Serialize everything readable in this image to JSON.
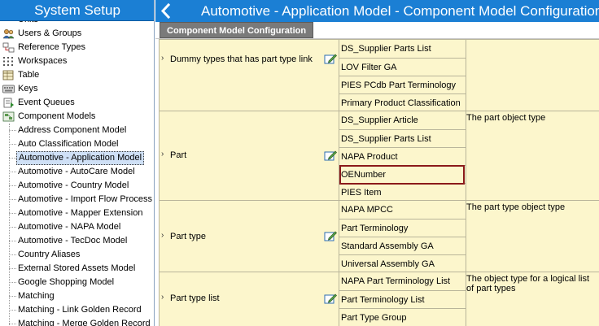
{
  "sidebar": {
    "title": "System Setup",
    "items": [
      {
        "label": "Units"
      },
      {
        "label": "Users & Groups"
      },
      {
        "label": "Reference Types"
      },
      {
        "label": "Workspaces"
      },
      {
        "label": "Table"
      },
      {
        "label": "Keys"
      },
      {
        "label": "Event Queues"
      },
      {
        "label": "Component Models"
      }
    ],
    "children": [
      {
        "label": "Address Component Model"
      },
      {
        "label": "Auto Classification Model"
      },
      {
        "label": "Automotive - Application Model"
      },
      {
        "label": "Automotive - AutoCare Model"
      },
      {
        "label": "Automotive - Country Model"
      },
      {
        "label": "Automotive - Import Flow Process"
      },
      {
        "label": "Automotive - Mapper Extension"
      },
      {
        "label": "Automotive - NAPA Model"
      },
      {
        "label": "Automotive - TecDoc Model"
      },
      {
        "label": "Country Aliases"
      },
      {
        "label": "External Stored Assets Model"
      },
      {
        "label": "Google Shopping Model"
      },
      {
        "label": "Matching"
      },
      {
        "label": "Matching - Link Golden Record"
      },
      {
        "label": "Matching - Merge Golden Record"
      }
    ]
  },
  "header": {
    "title": "Automotive - Application Model - Component Model Configuration"
  },
  "tab": {
    "label": "Component Model Configuration"
  },
  "rows": [
    {
      "name": "Dummy types that has part type link",
      "links": [
        "DS_Supplier Parts List",
        "LOV Filter GA",
        "PIES PCdb Part Terminology",
        "Primary Product Classification"
      ],
      "description": ""
    },
    {
      "name": "Part",
      "links": [
        "DS_Supplier Article",
        "DS_Supplier Parts List",
        "NAPA Product",
        "OENumber",
        "PIES Item"
      ],
      "description": "The part object type"
    },
    {
      "name": "Part type",
      "links": [
        "NAPA MPCC",
        "Part Terminology",
        "Standard Assembly GA",
        "Universal Assembly GA"
      ],
      "description": "The part type object type"
    },
    {
      "name": "Part type list",
      "links": [
        "NAPA Part Terminology List",
        "Part Terminology List",
        "Part Type Group"
      ],
      "description": "The object type for a logical list of part types"
    }
  ],
  "colors": {
    "header_blue": "#1b7fd4",
    "grid_yellow": "#fcf6cc",
    "highlight": "#8b1a1a",
    "selected": "#cfe0f6"
  }
}
